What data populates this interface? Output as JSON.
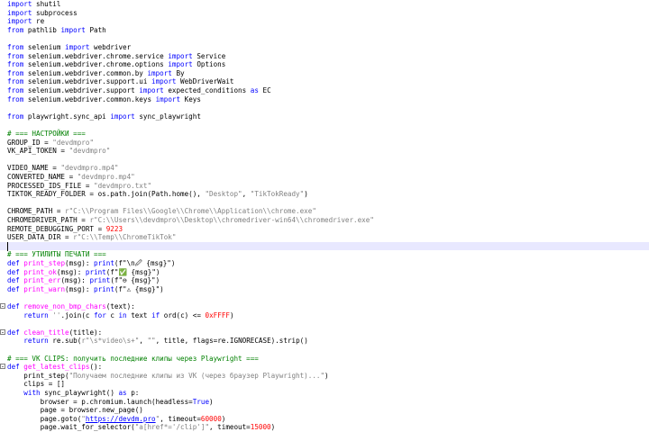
{
  "editor": {
    "lines": [
      [
        [
          "k",
          "import"
        ],
        [
          "p",
          " shutil"
        ]
      ],
      [
        [
          "k",
          "import"
        ],
        [
          "p",
          " subprocess"
        ]
      ],
      [
        [
          "k",
          "import"
        ],
        [
          "p",
          " re"
        ]
      ],
      [
        [
          "k",
          "from"
        ],
        [
          "p",
          " pathlib "
        ],
        [
          "k",
          "import"
        ],
        [
          "p",
          " Path"
        ]
      ],
      [],
      [
        [
          "k",
          "from"
        ],
        [
          "p",
          " selenium "
        ],
        [
          "k",
          "import"
        ],
        [
          "p",
          " webdriver"
        ]
      ],
      [
        [
          "k",
          "from"
        ],
        [
          "p",
          " selenium.webdriver.chrome.service "
        ],
        [
          "k",
          "import"
        ],
        [
          "p",
          " Service"
        ]
      ],
      [
        [
          "k",
          "from"
        ],
        [
          "p",
          " selenium.webdriver.chrome.options "
        ],
        [
          "k",
          "import"
        ],
        [
          "p",
          " Options"
        ]
      ],
      [
        [
          "k",
          "from"
        ],
        [
          "p",
          " selenium.webdriver.common.by "
        ],
        [
          "k",
          "import"
        ],
        [
          "p",
          " By"
        ]
      ],
      [
        [
          "k",
          "from"
        ],
        [
          "p",
          " selenium.webdriver.support.ui "
        ],
        [
          "k",
          "import"
        ],
        [
          "p",
          " WebDriverWait"
        ]
      ],
      [
        [
          "k",
          "from"
        ],
        [
          "p",
          " selenium.webdriver.support "
        ],
        [
          "k",
          "import"
        ],
        [
          "p",
          " expected_conditions "
        ],
        [
          "k",
          "as"
        ],
        [
          "p",
          " EC"
        ]
      ],
      [
        [
          "k",
          "from"
        ],
        [
          "p",
          " selenium.webdriver.common.keys "
        ],
        [
          "k",
          "import"
        ],
        [
          "p",
          " Keys"
        ]
      ],
      [],
      [
        [
          "k",
          "from"
        ],
        [
          "p",
          " playwright.sync_api "
        ],
        [
          "k",
          "import"
        ],
        [
          "p",
          " sync_playwright"
        ]
      ],
      [],
      [
        [
          "c",
          "# === НАСТРОЙКИ ==="
        ]
      ],
      [
        [
          "p",
          "GROUP_ID = "
        ],
        [
          "s",
          "\"devdmpro\""
        ]
      ],
      [
        [
          "p",
          "VK_API_TOKEN = "
        ],
        [
          "s",
          "\"devdmpro\""
        ]
      ],
      [],
      [
        [
          "p",
          "VIDEO_NAME = "
        ],
        [
          "s",
          "\"devdmpro.mp4\""
        ]
      ],
      [
        [
          "p",
          "CONVERTED_NAME = "
        ],
        [
          "s",
          "\"devdmpro.mp4\""
        ]
      ],
      [
        [
          "p",
          "PROCESSED_IDS_FILE = "
        ],
        [
          "s",
          "\"devdmpro.txt\""
        ]
      ],
      [
        [
          "p",
          "TIKTOK_READY_FOLDER = os.path.join(Path.home(), "
        ],
        [
          "s",
          "\"Desktop\""
        ],
        [
          "p",
          ", "
        ],
        [
          "s",
          "\"TikTokReady\""
        ],
        [
          "p",
          ")"
        ]
      ],
      [],
      [
        [
          "p",
          "CHROME_PATH = "
        ],
        [
          "s",
          "r\"C:\\\\Program Files\\\\Google\\\\Chrome\\\\Application\\\\chrome.exe\""
        ]
      ],
      [
        [
          "p",
          "CHROMEDRIVER_PATH = "
        ],
        [
          "s",
          "r\"C:\\\\Users\\\\devdmpro\\\\Desktop\\\\chromedriver-win64\\\\chromedriver.exe\""
        ]
      ],
      [
        [
          "p",
          "REMOTE_DEBUGGING_PORT = "
        ],
        [
          "n",
          "9223"
        ]
      ],
      [
        [
          "p",
          "USER_DATA_DIR = "
        ],
        [
          "s",
          "r\"C:\\\\Temp\\\\ChromeTikTok\""
        ]
      ],
      [],
      [
        [
          "c",
          "# === УТИЛИТЫ ПЕЧАТИ ==="
        ]
      ],
      [
        [
          "k",
          "def"
        ],
        [
          "p",
          " "
        ],
        [
          "fn",
          "print_step"
        ],
        [
          "p",
          "(msg): "
        ],
        [
          "k",
          "print"
        ],
        [
          "p",
          "(f\"\\n🖉 {msg}\")"
        ]
      ],
      [
        [
          "k",
          "def"
        ],
        [
          "p",
          " "
        ],
        [
          "fn",
          "print_ok"
        ],
        [
          "p",
          "(msg): "
        ],
        [
          "k",
          "print"
        ],
        [
          "p",
          "(f\"✅ {msg}\")"
        ]
      ],
      [
        [
          "k",
          "def"
        ],
        [
          "p",
          " "
        ],
        [
          "fn",
          "print_err"
        ],
        [
          "p",
          "(msg): "
        ],
        [
          "k",
          "print"
        ],
        [
          "p",
          "(f\"⊖ {msg}\")"
        ]
      ],
      [
        [
          "k",
          "def"
        ],
        [
          "p",
          " "
        ],
        [
          "fn",
          "print_warn"
        ],
        [
          "p",
          "(msg): "
        ],
        [
          "k",
          "print"
        ],
        [
          "p",
          "(f\"⚠ {msg}\")"
        ]
      ],
      [],
      [
        [
          "k",
          "def"
        ],
        [
          "p",
          " "
        ],
        [
          "fn",
          "remove_non_bmp_chars"
        ],
        [
          "p",
          "(text):"
        ]
      ],
      [
        [
          "p",
          "    "
        ],
        [
          "k",
          "return"
        ],
        [
          "p",
          " "
        ],
        [
          "s",
          "''"
        ],
        [
          "p",
          ".join(c "
        ],
        [
          "k",
          "for"
        ],
        [
          "p",
          " c "
        ],
        [
          "k",
          "in"
        ],
        [
          "p",
          " text "
        ],
        [
          "k",
          "if"
        ],
        [
          "p",
          " ord(c) <= "
        ],
        [
          "n",
          "0xFFFF"
        ],
        [
          "p",
          ")"
        ]
      ],
      [],
      [
        [
          "k",
          "def"
        ],
        [
          "p",
          " "
        ],
        [
          "fn",
          "clean_title"
        ],
        [
          "p",
          "(title):"
        ]
      ],
      [
        [
          "p",
          "    "
        ],
        [
          "k",
          "return"
        ],
        [
          "p",
          " re.sub("
        ],
        [
          "s",
          "r\"\\s*video\\s+\""
        ],
        [
          "p",
          ", "
        ],
        [
          "s",
          "\"\""
        ],
        [
          "p",
          ", title, flags=re.IGNORECASE).strip()"
        ]
      ],
      [],
      [
        [
          "c",
          "# === VK CLIPS: получить последние клипы через Playwright ==="
        ]
      ],
      [
        [
          "k",
          "def"
        ],
        [
          "p",
          " "
        ],
        [
          "fn",
          "get_latest_clips"
        ],
        [
          "p",
          "():"
        ]
      ],
      [
        [
          "p",
          "    print_step("
        ],
        [
          "s",
          "\"Получаем последние клипы из VK (через браузер Playwright)...\""
        ],
        [
          "p",
          ")"
        ]
      ],
      [
        [
          "p",
          "    clips = []"
        ]
      ],
      [
        [
          "p",
          "    "
        ],
        [
          "k",
          "with"
        ],
        [
          "p",
          " sync_playwright() "
        ],
        [
          "k",
          "as"
        ],
        [
          "p",
          " p:"
        ]
      ],
      [
        [
          "p",
          "        browser = p.chromium.launch(headless="
        ],
        [
          "k",
          "True"
        ],
        [
          "p",
          ")"
        ]
      ],
      [
        [
          "p",
          "        page = browser.new_page()"
        ]
      ],
      [
        [
          "p",
          "        page.goto("
        ],
        [
          "s",
          "\""
        ],
        [
          "u",
          "https://devdm.pro"
        ],
        [
          "s",
          "\""
        ],
        [
          "p",
          ", timeout="
        ],
        [
          "n",
          "60000"
        ],
        [
          "p",
          ")"
        ]
      ],
      [
        [
          "p",
          "        page.wait_for_selector("
        ],
        [
          "s",
          "\"a[href*='/clip']\""
        ],
        [
          "p",
          ", timeout="
        ],
        [
          "n",
          "15000"
        ],
        [
          "p",
          ")"
        ]
      ]
    ]
  }
}
